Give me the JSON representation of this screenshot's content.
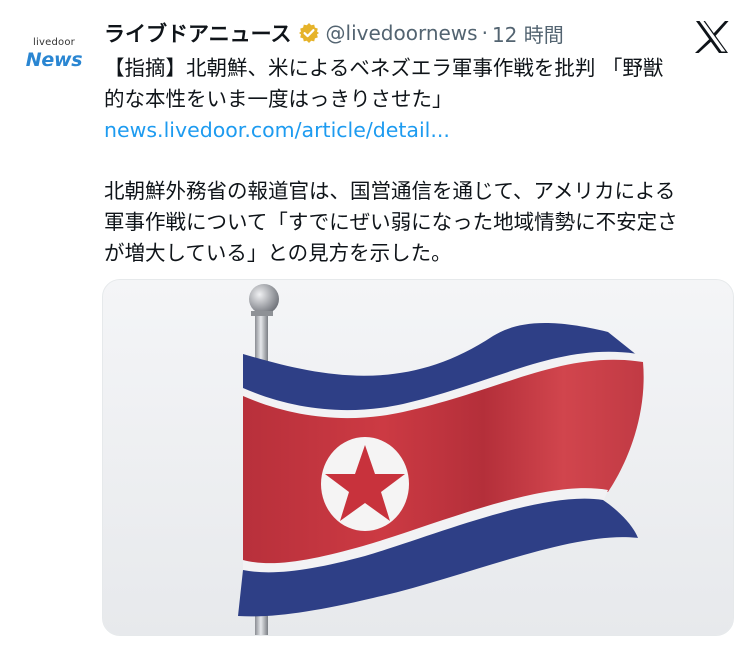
{
  "account": {
    "avatar_small": "livedoor",
    "avatar_big": "News",
    "name": "ライブドアニュース",
    "handle": "@livedoornews",
    "separator": "·",
    "time": "12 時間",
    "verified_color": "#e6b32a"
  },
  "post": {
    "headline_line1": "【指摘】北朝鮮、米によるベネズエラ軍事作戦を批判 「野獣",
    "headline_line2": "的な本性をいま一度はっきりさせた」",
    "link": "news.livedoor.com/article/detail...",
    "body_line1": "北朝鮮外務省の報道官は、国営通信を通じて、アメリカによる",
    "body_line2": "軍事作戦について「すでにぜい弱になった地域情勢に不安定さ",
    "body_line3": "が増大している」との見方を示した。"
  },
  "colors": {
    "link": "#1d9bf0",
    "text": "#0f1419",
    "secondary": "#536471",
    "flag_blue": "#2e3f86",
    "flag_red": "#c8323c"
  },
  "icons": {
    "verified": "verified-badge-icon",
    "platform": "x-logo-icon"
  }
}
